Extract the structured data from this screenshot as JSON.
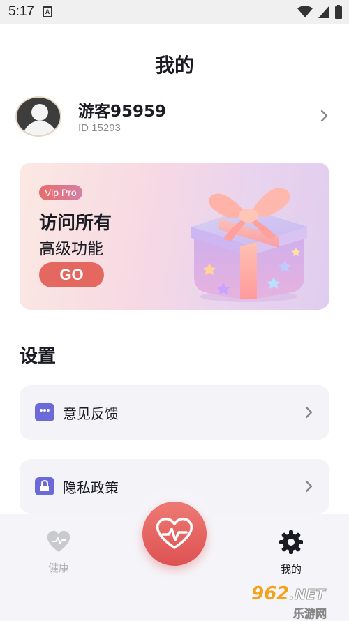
{
  "status_bar": {
    "time": "5:17",
    "notification_icon_letter": "A",
    "icons": [
      "wifi-icon",
      "signal-icon",
      "battery-icon"
    ]
  },
  "header": {
    "title": "我的"
  },
  "profile": {
    "name": "游客95959",
    "id_text": "ID 15293"
  },
  "vip_card": {
    "badge": "Vip Pro",
    "headline": "访问所有",
    "subline": "高级功能",
    "button_label": "GO"
  },
  "settings": {
    "title": "设置",
    "items": [
      {
        "label": "意见反馈",
        "icon": "chat-bubble-icon"
      },
      {
        "label": "隐私政策",
        "icon": "lock-icon"
      }
    ]
  },
  "bottom_nav": {
    "items": [
      {
        "label": "健康",
        "icon": "heart-icon",
        "active": false
      },
      {
        "label": "我的",
        "icon": "gear-icon",
        "active": true
      }
    ],
    "center_icon": "heart-pulse-icon"
  },
  "watermark": {
    "brand_num": "962",
    "brand_suffix": ".NET",
    "brand_cn": "乐游网"
  },
  "colors": {
    "accent_red": "#e4685f",
    "settings_icon": "#6b6ad8",
    "inactive_nav": "#b0b0b8",
    "text_dark": "#1b1b24"
  }
}
